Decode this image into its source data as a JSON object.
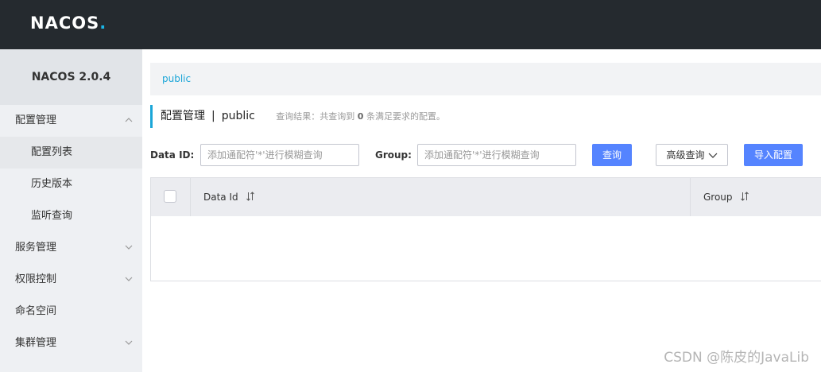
{
  "header": {
    "logo_prefix": "NA",
    "logo_oo": "CO",
    "logo_suffix": "S",
    "logo_dot": "."
  },
  "sidebar": {
    "title": "NACOS 2.0.4",
    "items": [
      {
        "label": "配置管理",
        "expandable": true,
        "expanded": true
      },
      {
        "label": "配置列表",
        "sub": true,
        "active": true
      },
      {
        "label": "历史版本",
        "sub": true
      },
      {
        "label": "监听查询",
        "sub": true
      },
      {
        "label": "服务管理",
        "expandable": true
      },
      {
        "label": "权限控制",
        "expandable": true
      },
      {
        "label": "命名空间"
      },
      {
        "label": "集群管理",
        "expandable": true
      }
    ]
  },
  "breadcrumb": {
    "namespace": "public"
  },
  "page": {
    "title": "配置管理",
    "separator": "|",
    "namespace": "public",
    "result_prefix": "查询结果：共查询到",
    "result_count": "0",
    "result_suffix": "条满足要求的配置。"
  },
  "search": {
    "dataid_label": "Data ID:",
    "dataid_placeholder": "添加通配符'*'进行模糊查询",
    "group_label": "Group:",
    "group_placeholder": "添加通配符'*'进行模糊查询",
    "query_button": "查询",
    "advanced_button": "高级查询",
    "import_button": "导入配置"
  },
  "table": {
    "columns": [
      "Data Id",
      "Group"
    ],
    "rows": []
  },
  "watermark": "CSDN @陈皮的JavaLib",
  "colors": {
    "accent": "#1ba6d8",
    "primary_button": "#5584ff",
    "topbar": "#252a2f"
  }
}
